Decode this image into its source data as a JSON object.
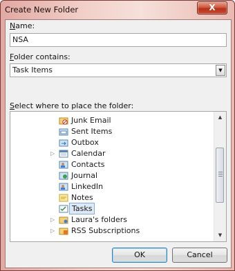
{
  "window": {
    "title": "Create New Folder",
    "close_glyph": "X"
  },
  "name_field": {
    "label_mnemonic": "N",
    "label_rest": "ame:",
    "value": "NSA"
  },
  "contains_field": {
    "label_mnemonic": "F",
    "label_rest": "older contains:",
    "value": "Task Items"
  },
  "location": {
    "label_mnemonic": "S",
    "label_rest": "elect where to place the folder:"
  },
  "tree": {
    "items": [
      {
        "label": "Junk Email",
        "icon": "junk-email-folder-icon",
        "expandable": false,
        "selected": false
      },
      {
        "label": "Sent Items",
        "icon": "sent-items-folder-icon",
        "expandable": false,
        "selected": false
      },
      {
        "label": "Outbox",
        "icon": "outbox-folder-icon",
        "expandable": false,
        "selected": false
      },
      {
        "label": "Calendar",
        "icon": "calendar-folder-icon",
        "expandable": true,
        "selected": false
      },
      {
        "label": "Contacts",
        "icon": "contacts-folder-icon",
        "expandable": false,
        "selected": false
      },
      {
        "label": "Journal",
        "icon": "journal-folder-icon",
        "expandable": false,
        "selected": false
      },
      {
        "label": "LinkedIn",
        "icon": "contacts-folder-icon",
        "expandable": false,
        "selected": false
      },
      {
        "label": "Notes",
        "icon": "notes-folder-icon",
        "expandable": false,
        "selected": false
      },
      {
        "label": "Tasks",
        "icon": "tasks-folder-icon",
        "expandable": false,
        "selected": true
      },
      {
        "label": "Laura's folders",
        "icon": "shared-folder-icon",
        "expandable": true,
        "selected": false
      },
      {
        "label": "RSS Subscriptions",
        "icon": "rss-folder-icon",
        "expandable": true,
        "selected": false
      }
    ],
    "expander_glyph": "▷",
    "scroll_up_glyph": "▲",
    "scroll_down_glyph": "▼"
  },
  "buttons": {
    "ok": "OK",
    "cancel": "Cancel"
  },
  "colors": {
    "title_accent": "#e2a9a3",
    "close_red": "#c9492f",
    "selection": "#dde9f7"
  }
}
